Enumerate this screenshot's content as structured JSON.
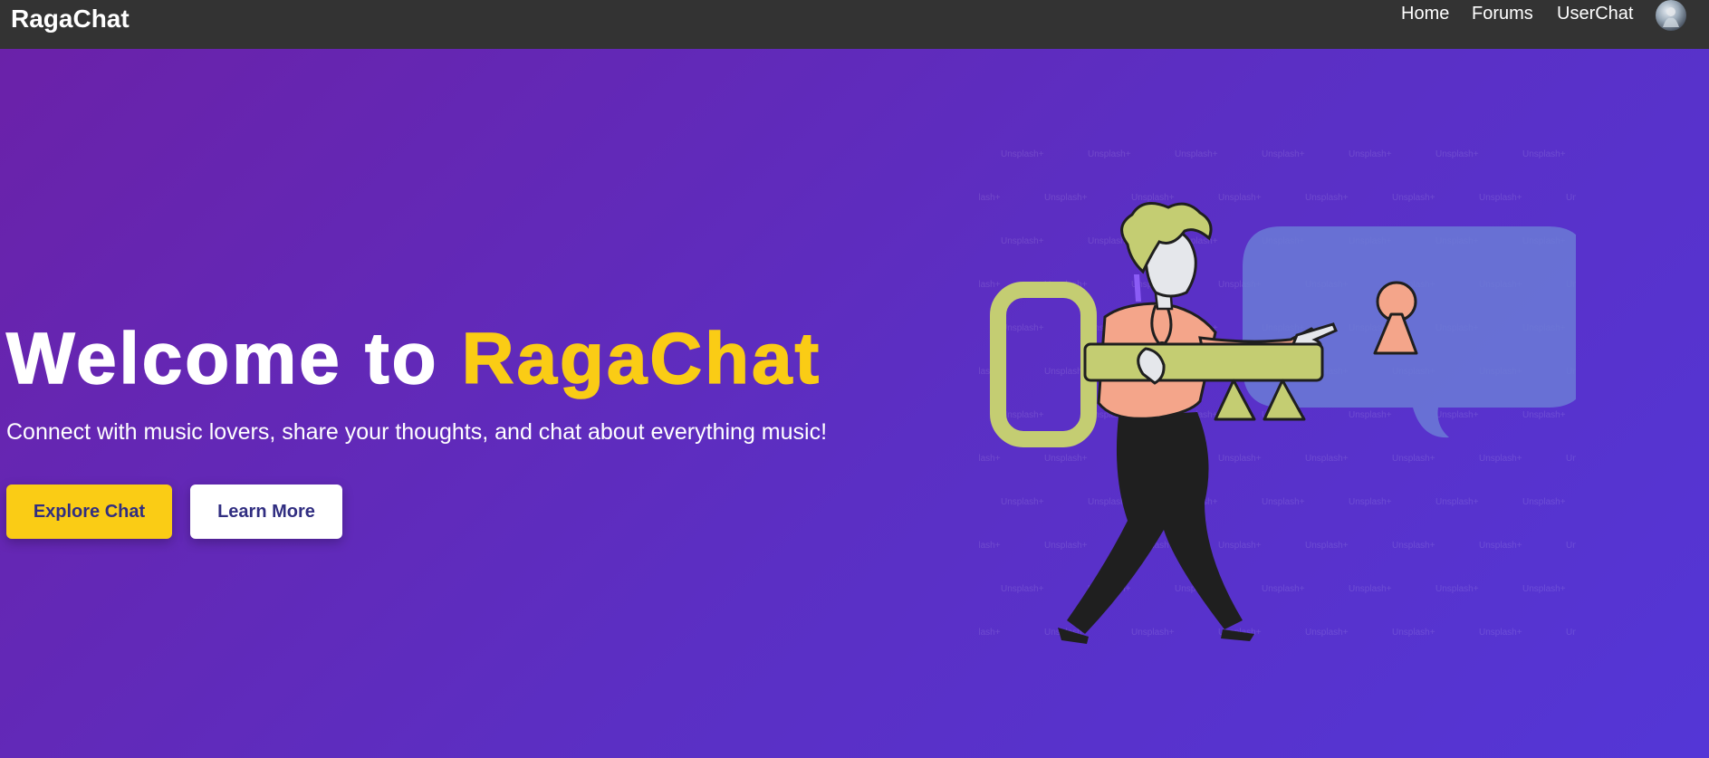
{
  "nav": {
    "brand": "RagaChat",
    "links": [
      "Home",
      "Forums",
      "UserChat"
    ]
  },
  "hero": {
    "title_lead": "Welcome to ",
    "title_accent": "RagaChat",
    "subtitle": "Connect with music lovers, share your thoughts, and chat about everything music!",
    "buttons": {
      "explore": "Explore Chat",
      "learn": "Learn More"
    }
  },
  "watermark": "Unsplash+",
  "colors": {
    "navbar": "#333333",
    "accent": "#facc15",
    "button_text": "#312e81",
    "gradient_start": "#6b21a8",
    "gradient_end": "#5436d6"
  }
}
